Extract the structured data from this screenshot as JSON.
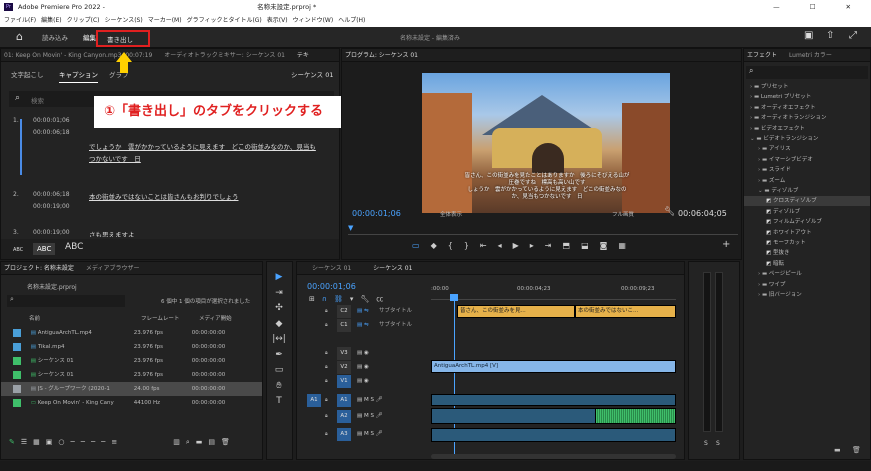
{
  "titlebar": {
    "title": "Adobe Premiere Pro 2022 - ",
    "doc": "名称未設定.prproj *"
  },
  "menu": [
    "ファイル(F)",
    "編集(E)",
    "クリップ(C)",
    "シーケンス(S)",
    "マーカー(M)",
    "グラフィックとタイトル(G)",
    "表示(V)",
    "ウィンドウ(W)",
    "ヘルプ(H)"
  ],
  "header": {
    "tabs": [
      "読み込み",
      "編集",
      "書き出し"
    ],
    "center": "名称未設定 - 編集済み"
  },
  "annotation": {
    "text": "①「書き出し」のタブをクリックする"
  },
  "captions_panel": {
    "title1": "01: Keep On Movin' - King Canyon.mp3: 00:07:19",
    "title2": "オーディオトラックミキサー: シーケンス 01",
    "title3": "テキ",
    "tabs": [
      "文字起こし",
      "キャプション",
      "グラフ"
    ],
    "seq": "シーケンス 01",
    "search": "検索",
    "items": [
      {
        "num": "1.",
        "in": "00:00:01;06",
        "out": "00:00:06;18",
        "text": "でしょうか　雲がかかっているように見えます　どこの街並みなのか、見当もつかないです　日"
      },
      {
        "num": "2.",
        "in": "00:00:06;18",
        "out": "00:00:19;00",
        "text": "本の街並みではないことは皆さんもお判りでしょう"
      },
      {
        "num": "3.",
        "in": "00:00:19;00",
        "out": "",
        "text": "さも思えますよ"
      }
    ],
    "abc": [
      "ABC",
      "ABC",
      "ABC"
    ]
  },
  "program": {
    "title": "プログラム: シーケンス 01",
    "timecode": "00:00:01;06",
    "fit": "全体表示",
    "quality": "フル画質",
    "duration": "00:06:04;05",
    "subtitle": [
      "皆さん、この街並みを見たことはありますか　後ろにそびえる山が",
      "圧巻ですね　標高も高い山です",
      "しょうか　雲がかかっているように見えます　どこの街並みなの",
      "か、見当もつかないです　日"
    ]
  },
  "effects": {
    "tabs": [
      "エフェクト",
      "Lumetri カラー"
    ],
    "items": [
      {
        "label": "プリセット",
        "lvl": 0,
        "type": "folder"
      },
      {
        "label": "Lumetri プリセット",
        "lvl": 0,
        "type": "folder"
      },
      {
        "label": "オーディオエフェクト",
        "lvl": 0,
        "type": "folder"
      },
      {
        "label": "オーディオトランジション",
        "lvl": 0,
        "type": "folder"
      },
      {
        "label": "ビデオエフェクト",
        "lvl": 0,
        "type": "folder"
      },
      {
        "label": "ビデオトランジション",
        "lvl": 0,
        "type": "folder",
        "open": true
      },
      {
        "label": "アイリス",
        "lvl": 1,
        "type": "folder"
      },
      {
        "label": "イマーシブビデオ",
        "lvl": 1,
        "type": "folder"
      },
      {
        "label": "スライド",
        "lvl": 1,
        "type": "folder"
      },
      {
        "label": "ズーム",
        "lvl": 1,
        "type": "folder"
      },
      {
        "label": "ディゾルブ",
        "lvl": 1,
        "type": "folder",
        "open": true
      },
      {
        "label": "クロスディゾルブ",
        "lvl": 2,
        "type": "fx",
        "sel": true
      },
      {
        "label": "ディゾルブ",
        "lvl": 2,
        "type": "fx"
      },
      {
        "label": "フィルムディゾルブ",
        "lvl": 2,
        "type": "fx"
      },
      {
        "label": "ホワイトアウト",
        "lvl": 2,
        "type": "fx"
      },
      {
        "label": "モーフカット",
        "lvl": 2,
        "type": "fx"
      },
      {
        "label": "型抜き",
        "lvl": 2,
        "type": "fx"
      },
      {
        "label": "暗転",
        "lvl": 2,
        "type": "fx"
      },
      {
        "label": "ページピール",
        "lvl": 1,
        "type": "folder"
      },
      {
        "label": "ワイプ",
        "lvl": 1,
        "type": "folder"
      },
      {
        "label": "旧バージョン",
        "lvl": 1,
        "type": "folder"
      }
    ]
  },
  "project": {
    "tabs": [
      "プロジェクト: 名称未設定",
      "メディアブラウザー"
    ],
    "file": "名称未設定.prproj",
    "count": "6 個中 1 個の項目が選択されました",
    "cols": [
      "名前",
      "フレームレート",
      "メディア開始"
    ],
    "rows": [
      {
        "color": "#4a9fd8",
        "name": "AntiguaArchTL.mp4",
        "fps": "23.976 fps",
        "start": "00:00:00:00"
      },
      {
        "color": "#4a9fd8",
        "name": "Tikal.mp4",
        "fps": "23.976 fps",
        "start": "00:00:00:00"
      },
      {
        "color": "#3fbf6a",
        "name": "シーケンス 01",
        "fps": "23.976 fps",
        "start": "00:00:00:00"
      },
      {
        "color": "#3fbf6a",
        "name": "シーケンス 01",
        "fps": "23.976 fps",
        "start": "00:00:00:00"
      },
      {
        "color": "#9aa0a6",
        "name": "JS - グループワーク (2020-1",
        "fps": "24.00 fps",
        "start": "00:00:00:00",
        "sel": true
      },
      {
        "color": "#3fbf6a",
        "name": "Keep On Movin' - King Cany",
        "fps": "44100 Hz",
        "start": "00:00:00:00"
      }
    ]
  },
  "timeline": {
    "tabs": [
      "シーケンス 01",
      "シーケンス 01"
    ],
    "timecode": "00:00:01;06",
    "ruler": [
      ":00:00",
      "00:00:04;23",
      "00:00:09;23"
    ],
    "tracks": [
      {
        "id": "C2",
        "name": "サブタイトル",
        "type": "cap"
      },
      {
        "id": "C1",
        "name": "サブタイトル",
        "type": "cap"
      },
      {
        "id": "V3",
        "type": "v"
      },
      {
        "id": "V2",
        "type": "v"
      },
      {
        "id": "V1",
        "type": "v"
      },
      {
        "id": "A1",
        "type": "a"
      },
      {
        "id": "A2",
        "type": "a"
      },
      {
        "id": "A3",
        "type": "a"
      }
    ],
    "clips": {
      "cap1": "皆さん、この街並みを見...",
      "cap2": "本の街並みではないこ...",
      "video": "AntiguaArchTL.mp4 [V]"
    },
    "ms": [
      "S",
      "S"
    ]
  }
}
